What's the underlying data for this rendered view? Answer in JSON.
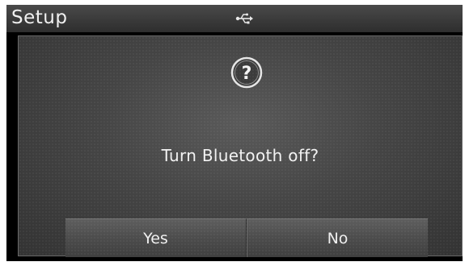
{
  "header": {
    "title": "Setup",
    "status_icon": "usb-icon"
  },
  "dialog": {
    "icon": "question-icon",
    "message": "Turn Bluetooth off?",
    "yes_label": "Yes",
    "no_label": "No"
  },
  "colors": {
    "background": "#000000",
    "dialog_fill": "#454545",
    "text": "#f0f0f0"
  }
}
